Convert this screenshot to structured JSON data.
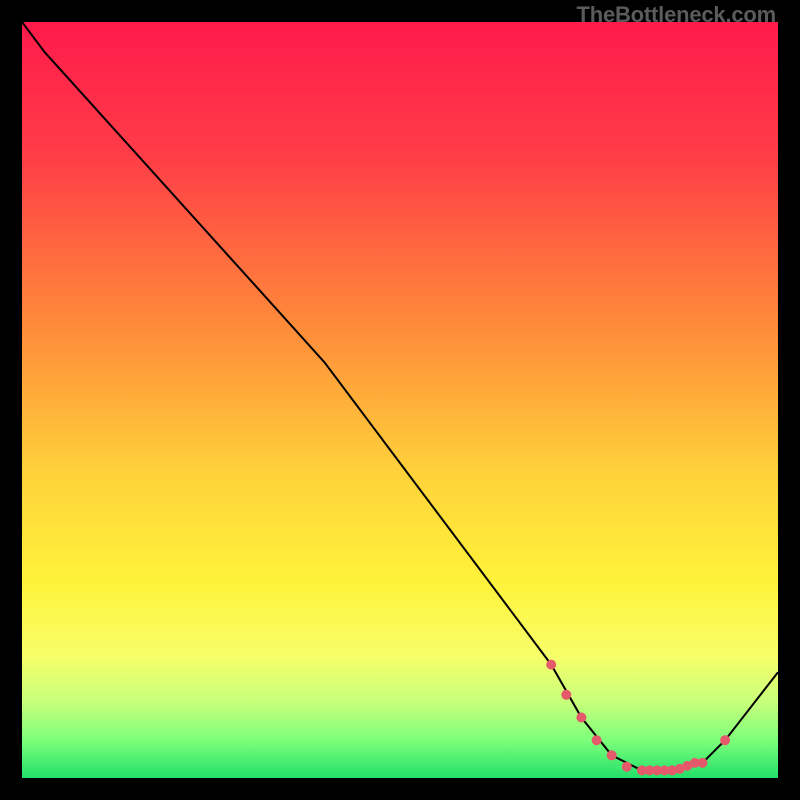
{
  "watermark": "TheBottleneck.com",
  "chart_data": {
    "type": "line",
    "title": "",
    "xlabel": "",
    "ylabel": "",
    "xlim": [
      0,
      100
    ],
    "ylim": [
      0,
      100
    ],
    "x": [
      0,
      3,
      40,
      70,
      74,
      78,
      82,
      86,
      90,
      93,
      100
    ],
    "values": [
      100,
      96,
      55,
      15,
      8,
      3,
      1,
      1,
      2,
      5,
      14
    ],
    "markers": {
      "x": [
        70,
        72,
        74,
        76,
        78,
        80,
        82,
        83,
        84,
        85,
        86,
        87,
        88,
        89,
        90,
        93
      ],
      "values": [
        15,
        11,
        8,
        5,
        3,
        1.5,
        1,
        1,
        1,
        1,
        1,
        1.2,
        1.6,
        2,
        2,
        5
      ]
    },
    "gradient_stops": [
      {
        "offset": 0.0,
        "color": "#ff1a4b"
      },
      {
        "offset": 0.18,
        "color": "#ff3e47"
      },
      {
        "offset": 0.4,
        "color": "#ff8a3a"
      },
      {
        "offset": 0.6,
        "color": "#ffd33a"
      },
      {
        "offset": 0.74,
        "color": "#fff23a"
      },
      {
        "offset": 0.84,
        "color": "#f6ff6a"
      },
      {
        "offset": 0.9,
        "color": "#c7ff7a"
      },
      {
        "offset": 0.95,
        "color": "#7dff7a"
      },
      {
        "offset": 1.0,
        "color": "#22e06a"
      }
    ],
    "line_color": "#000000",
    "marker_color": "#e55a6a",
    "marker_radius": 5
  }
}
